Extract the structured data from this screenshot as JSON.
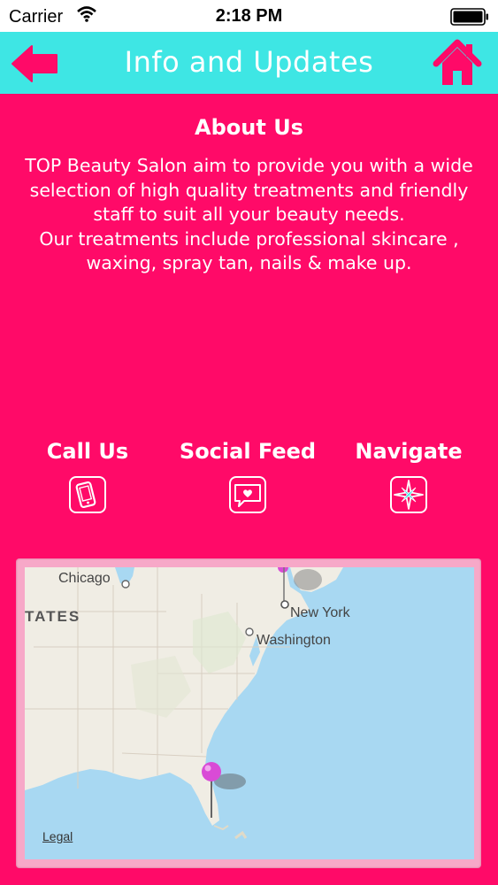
{
  "status_bar": {
    "carrier": "Carrier",
    "time": "2:18 PM"
  },
  "nav": {
    "title": "Info and Updates"
  },
  "about": {
    "title": "About Us",
    "text": "TOP Beauty Salon aim to provide you with a wide selection of high quality treatments and friendly staff to suit all your beauty needs.\nOur treatments include professional skincare , waxing, spray tan, nails & make up."
  },
  "actions": [
    {
      "label": "Call Us",
      "icon": "phone-icon"
    },
    {
      "label": "Social Feed",
      "icon": "chat-bubble-icon"
    },
    {
      "label": "Navigate",
      "icon": "compass-icon"
    }
  ],
  "map": {
    "labels": {
      "chicago": "Chicago",
      "states": "TATES",
      "new_york": "New York",
      "washington": "Washington"
    },
    "legal": "Legal"
  },
  "colors": {
    "background": "#FF0A68",
    "nav_bar": "#3EE6E4",
    "water": "#A8D8F2",
    "land": "#F0EDE4",
    "pin": "#D94BD6"
  }
}
